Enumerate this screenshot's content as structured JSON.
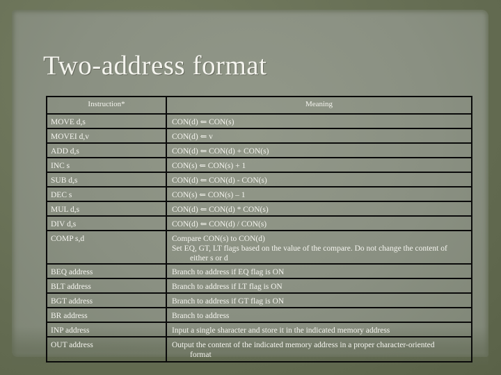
{
  "title": "Two-address format",
  "table": {
    "headers": [
      "Instruction*",
      "Meaning"
    ],
    "rows": [
      {
        "instruction": "MOVE d,s",
        "meaning": [
          "CON(d) ⇐ CON(s)"
        ]
      },
      {
        "instruction": "MOVEI d,v",
        "meaning": [
          "CON(d) ⇐ v"
        ]
      },
      {
        "instruction": "ADD d,s",
        "meaning": [
          "CON(d) ⇐ CON(d) + CON(s)"
        ]
      },
      {
        "instruction": "INC s",
        "meaning": [
          "CON(s) ⇐ CON(s) + 1"
        ]
      },
      {
        "instruction": "SUB d,s",
        "meaning": [
          "CON(d) ⇐ CON(d) - CON(s)"
        ]
      },
      {
        "instruction": "DEC s",
        "meaning": [
          "CON(s) ⇐ CON(s) – 1"
        ]
      },
      {
        "instruction": "MUL d,s",
        "meaning": [
          "CON(d) ⇐ CON(d) * CON(s)"
        ]
      },
      {
        "instruction": "DIV d,s",
        "meaning": [
          "CON(d) ⇐ CON(d) / CON(s)"
        ]
      },
      {
        "instruction": "COMP s,d",
        "meaning": [
          "Compare  CON(s) to CON(d)",
          "Set EQ, GT, LT flags based on the value of the compare. Do not change the content of",
          "either s or d"
        ]
      },
      {
        "instruction": "BEQ address",
        "meaning": [
          "Branch to address if EQ flag is ON"
        ]
      },
      {
        "instruction": "BLT address",
        "meaning": [
          "Branch to address if LT flag is ON"
        ]
      },
      {
        "instruction": "BGT address",
        "meaning": [
          "Branch to address if GT flag is ON"
        ]
      },
      {
        "instruction": "BR address",
        "meaning": [
          "Branch to address"
        ]
      },
      {
        "instruction": "INP address",
        "meaning": [
          "Input a single sharacter and store it in the indicated memory address"
        ]
      },
      {
        "instruction": "OUT address",
        "meaning": [
          "Output the content of the indicated memory address in a proper character-oriented",
          "format"
        ]
      }
    ]
  }
}
